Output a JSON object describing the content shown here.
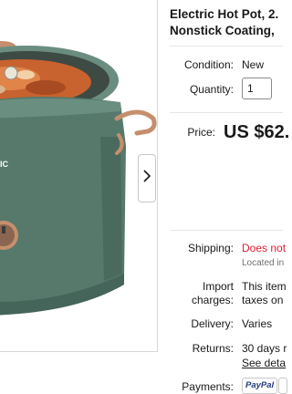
{
  "gallery": {
    "next_icon": "chevron-right-icon",
    "product_image": "green electric hot pot with copper handles and glass lid",
    "colors": {
      "pot_green": "#56796b",
      "copper": "#c58f6d"
    }
  },
  "listing": {
    "title_line1": "Electric Hot Pot, 2.",
    "title_line2": "Nonstick Coating,"
  },
  "condition": {
    "label": "Condition:",
    "value": "New"
  },
  "quantity": {
    "label": "Quantity:",
    "value": "1"
  },
  "price": {
    "label": "Price:",
    "value": "US $62."
  },
  "shipping": {
    "label": "Shipping:",
    "value": "Does not",
    "sub": "Located in",
    "value_color": "#dd1e31"
  },
  "import_charges": {
    "label_line1": "Import",
    "label_line2": "charges:",
    "value_line1": "This item",
    "value_line2": "taxes on"
  },
  "delivery": {
    "label": "Delivery:",
    "value": "Varies"
  },
  "returns": {
    "label": "Returns:",
    "value_line1": "30 days r",
    "value_line2": "See deta"
  },
  "payments": {
    "label": "Payments:",
    "badges": [
      "PayPal"
    ]
  }
}
